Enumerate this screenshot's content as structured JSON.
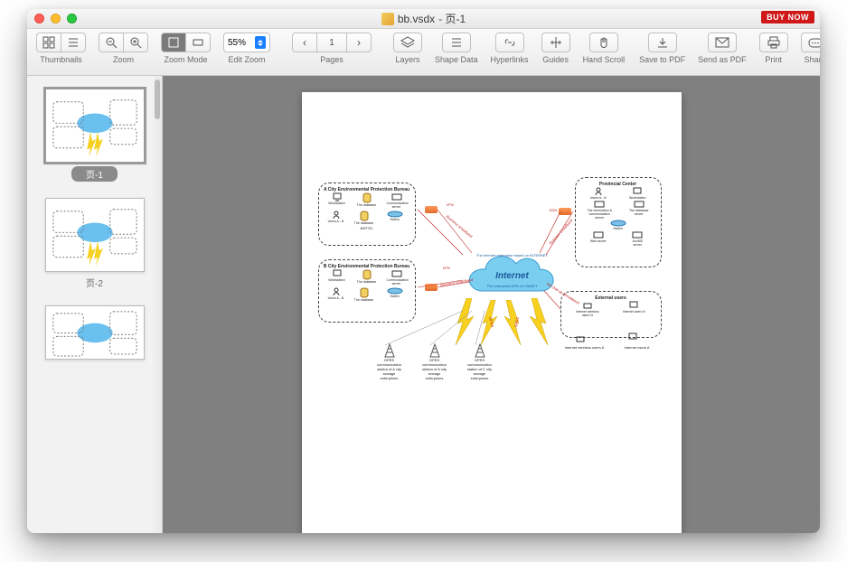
{
  "titlebar": {
    "filename": "bb.vsdx",
    "page_suffix": " - 页-1",
    "buy_now": "BUY NOW"
  },
  "toolbar": {
    "thumbnails": "Thumbnails",
    "zoom": "Zoom",
    "zoom_mode": "Zoom Mode",
    "edit_zoom": "Edit Zoom",
    "zoom_value": "55%",
    "pages": "Pages",
    "page_current": "1",
    "layers": "Layers",
    "shape_data": "Shape Data",
    "hyperlinks": "Hyperlinks",
    "guides": "Guides",
    "hand_scroll": "Hand Scroll",
    "save_pdf": "Save to PDF",
    "send_pdf": "Send as PDF",
    "print": "Print",
    "share": "Share"
  },
  "sidebar": {
    "thumbs": [
      {
        "label": "页-1",
        "selected": true
      },
      {
        "label": "页-2",
        "selected": false
      },
      {
        "label": "",
        "selected": false
      }
    ]
  },
  "diagram": {
    "cloud_main": "Internet",
    "cloud_top": "The Internet enterprise based on INTERNET",
    "cloud_bottom": "The enterprise APN on CMNET",
    "boxes": {
      "a_city": "A City Environmental Protection Bureau",
      "b_city": "B City Environmental Protection Bureau",
      "provincial": "Provincial Center",
      "external": "External users",
      "mstsc": "MSTSC"
    },
    "nodes": {
      "workstation": "Workstation",
      "database": "The database",
      "comm_server": "Communication server",
      "switch": "Switch",
      "users_an": "Users A...N",
      "web_server": "Web server",
      "arcims_server": "ArcIMS server",
      "info_comm": "The information & communication server",
      "db_server": "The database server",
      "internet_wireless_n": "Internet wireless users N",
      "internet_users_n": "Internet users N",
      "internet_wireless_a": "Internet wireless users A",
      "internet_users_a": "Internet users A"
    },
    "links": {
      "vpn": "VPN",
      "business_broadband": "Business broadband",
      "ddn": "DDN",
      "net_dialup": "Net Dial-up /Broadband",
      "gprs": "GPRS"
    },
    "towers": [
      "GPRS communication station of A city sewage enterprises",
      "GPRS communication station of A city sewage enterprises",
      "GPRS communication station of C city sewage enterprises"
    ]
  }
}
